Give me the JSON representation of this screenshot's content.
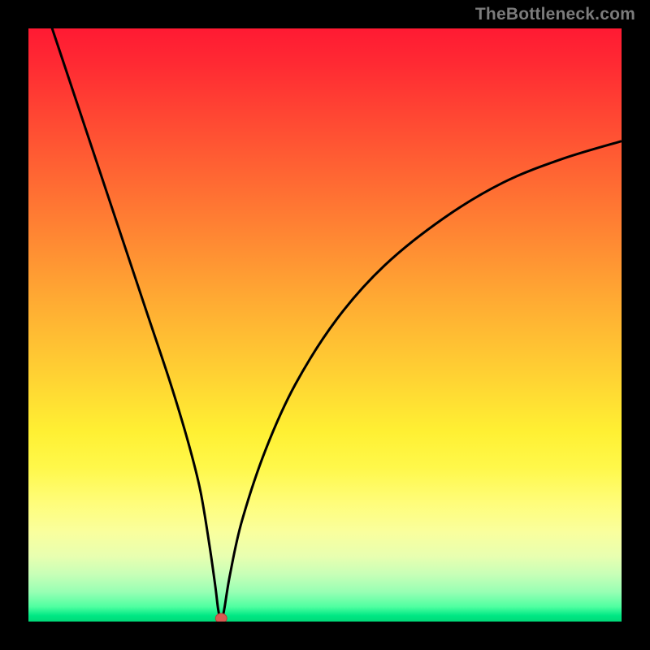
{
  "watermark": {
    "text": "TheBottleneck.com"
  },
  "colors": {
    "curve_stroke": "#000000",
    "marker_fill": "#d85a52",
    "marker_stroke": "#b84038",
    "background": "#000000"
  },
  "chart_data": {
    "type": "line",
    "title": "",
    "xlabel": "",
    "ylabel": "",
    "xlim": [
      0,
      100
    ],
    "ylim": [
      0,
      100
    ],
    "grid": false,
    "legend": false,
    "series": [
      {
        "name": "bottleneck-curve",
        "x": [
          3,
          5,
          8,
          12,
          16,
          20,
          24,
          27,
          29,
          30.5,
          31.5,
          32,
          32.5,
          33,
          34,
          36,
          40,
          45,
          52,
          60,
          70,
          80,
          90,
          100
        ],
        "y": [
          103,
          97,
          88,
          76,
          64,
          52,
          40,
          30,
          22,
          13,
          6,
          2,
          0,
          2,
          8,
          17,
          29,
          40,
          51,
          60,
          68,
          74,
          78,
          81
        ]
      }
    ],
    "annotations": [
      {
        "name": "minimum-marker",
        "x": 32.5,
        "y": 0
      }
    ]
  }
}
